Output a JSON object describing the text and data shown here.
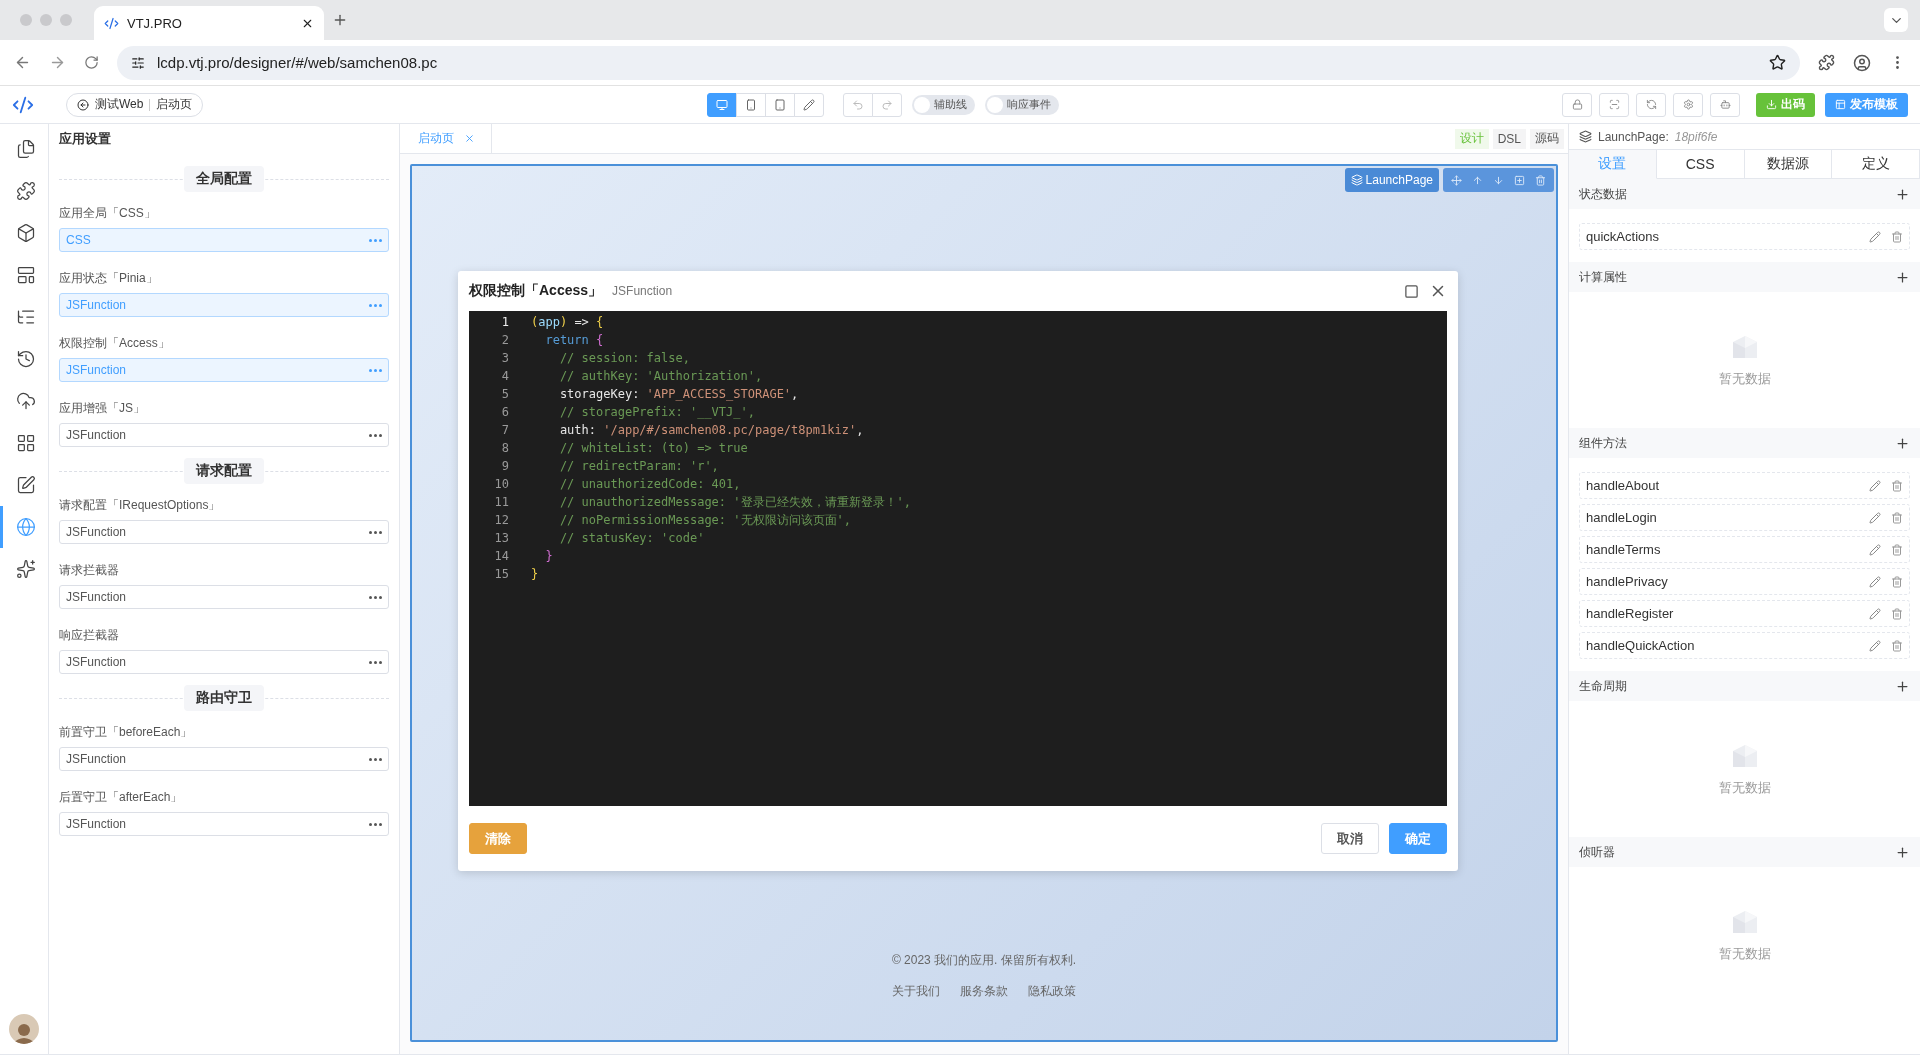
{
  "browser": {
    "tab_title": "VTJ.PRO",
    "url": "lcdp.vtj.pro/designer/#/web/samchen08.pc"
  },
  "toolbar": {
    "breadcrumb": [
      "测试Web",
      "启动页"
    ],
    "devices": [
      {
        "kind": "desktop",
        "selected": true
      },
      {
        "kind": "mobile",
        "selected": false
      },
      {
        "kind": "tablet",
        "selected": false
      },
      {
        "kind": "pen",
        "selected": false
      }
    ],
    "toggles": [
      {
        "label": "辅助线",
        "on": false
      },
      {
        "label": "响应事件",
        "on": false
      }
    ],
    "export_button": "出码",
    "publish_button": "发布模板"
  },
  "rail": [
    {
      "kind": "pages",
      "selected": false
    },
    {
      "kind": "plugins",
      "selected": false
    },
    {
      "kind": "components",
      "selected": false
    },
    {
      "kind": "templates",
      "selected": false
    },
    {
      "kind": "outline",
      "selected": false
    },
    {
      "kind": "history",
      "selected": false
    },
    {
      "kind": "api",
      "selected": false
    },
    {
      "kind": "apps",
      "selected": false
    },
    {
      "kind": "edit",
      "selected": false
    },
    {
      "kind": "globe",
      "selected": true
    },
    {
      "kind": "ai",
      "selected": false
    }
  ],
  "settings": {
    "title": "应用设置",
    "groups": [
      {
        "heading": "全局配置",
        "fields": [
          {
            "label": "应用全局「CSS」",
            "value": "CSS",
            "active": true
          },
          {
            "label": "应用状态「Pinia」",
            "value": "JSFunction",
            "active": true
          },
          {
            "label": "权限控制「Access」",
            "value": "JSFunction",
            "active": true
          },
          {
            "label": "应用增强「JS」",
            "value": "JSFunction",
            "active": false
          }
        ]
      },
      {
        "heading": "请求配置",
        "fields": [
          {
            "label": "请求配置「IRequestOptions」",
            "value": "JSFunction",
            "active": false
          },
          {
            "label": "请求拦截器",
            "value": "JSFunction",
            "active": false
          },
          {
            "label": "响应拦截器",
            "value": "JSFunction",
            "active": false
          }
        ]
      },
      {
        "heading": "路由守卫",
        "fields": [
          {
            "label": "前置守卫「beforeEach」",
            "value": "JSFunction",
            "active": false
          },
          {
            "label": "后置守卫「afterEach」",
            "value": "JSFunction",
            "active": false
          }
        ]
      }
    ]
  },
  "canvas": {
    "page_tab": "启动页",
    "views": [
      {
        "label": "设计",
        "selected": true
      },
      {
        "label": "DSL",
        "selected": false
      },
      {
        "label": "源码",
        "selected": false
      }
    ],
    "node_badge": "LaunchPage",
    "footer_text": "© 2023 我们的应用. 保留所有权利.",
    "footer_links": [
      "关于我们",
      "服务条款",
      "隐私政策"
    ]
  },
  "dialog": {
    "title": "权限控制「Access」",
    "subtitle": "JSFunction",
    "code": [
      [
        {
          "kind": "bracket",
          "text": "("
        },
        {
          "kind": "param",
          "text": "app"
        },
        {
          "kind": "bracket",
          "text": ")"
        },
        {
          "kind": "plain",
          "text": " => "
        },
        {
          "kind": "bracket",
          "text": "{"
        }
      ],
      [
        {
          "kind": "keyword",
          "text": "  return "
        },
        {
          "kind": "bracket2",
          "text": "{"
        }
      ],
      [
        {
          "kind": "comment",
          "text": "    // session: false,"
        }
      ],
      [
        {
          "kind": "comment",
          "text": "    // authKey: 'Authorization',"
        }
      ],
      [
        {
          "kind": "plain",
          "text": "    storageKey: "
        },
        {
          "kind": "string",
          "text": "'APP_ACCESS_STORAGE'"
        },
        {
          "kind": "plain",
          "text": ","
        }
      ],
      [
        {
          "kind": "comment",
          "text": "    // storagePrefix: '__VTJ_',"
        }
      ],
      [
        {
          "kind": "plain",
          "text": "    auth: "
        },
        {
          "kind": "string",
          "text": "'/app/#/samchen08.pc/page/t8pm1kiz'"
        },
        {
          "kind": "plain",
          "text": ","
        }
      ],
      [
        {
          "kind": "comment",
          "text": "    // whiteList: (to) => true"
        }
      ],
      [
        {
          "kind": "comment",
          "text": "    // redirectParam: 'r',"
        }
      ],
      [
        {
          "kind": "comment",
          "text": "    // unauthorizedCode: 401,"
        }
      ],
      [
        {
          "kind": "comment",
          "text": "    // unauthorizedMessage: '登录已经失效，请重新登录！',"
        }
      ],
      [
        {
          "kind": "comment",
          "text": "    // noPermissionMessage: '无权限访问该页面',"
        }
      ],
      [
        {
          "kind": "comment",
          "text": "    // statusKey: 'code'"
        }
      ],
      [
        {
          "kind": "bracket2",
          "text": "  }"
        }
      ],
      [
        {
          "kind": "bracket",
          "text": "}"
        }
      ]
    ],
    "line_numbers": [
      "1",
      "2",
      "3",
      "4",
      "5",
      "6",
      "7",
      "8",
      "9",
      "10",
      "11",
      "12",
      "13",
      "14",
      "15"
    ],
    "clear_button": "清除",
    "cancel_button": "取消",
    "ok_button": "确定"
  },
  "inspector": {
    "component": "LaunchPage:",
    "id": "18pif6fe",
    "tabs": [
      {
        "label": "设置",
        "selected": true
      },
      {
        "label": "CSS",
        "selected": false
      },
      {
        "label": "数据源",
        "selected": false
      },
      {
        "label": "定义",
        "selected": false
      }
    ],
    "sections": [
      {
        "title": "状态数据",
        "items": [
          "quickActions"
        ]
      },
      {
        "title": "计算属性",
        "empty_text": "暂无数据"
      },
      {
        "title": "组件方法",
        "items": [
          "handleAbout",
          "handleLogin",
          "handleTerms",
          "handlePrivacy",
          "handleRegister",
          "handleQuickAction"
        ]
      },
      {
        "title": "生命周期",
        "empty_text": "暂无数据"
      },
      {
        "title": "侦听器",
        "empty_text": "暂无数据"
      }
    ]
  }
}
